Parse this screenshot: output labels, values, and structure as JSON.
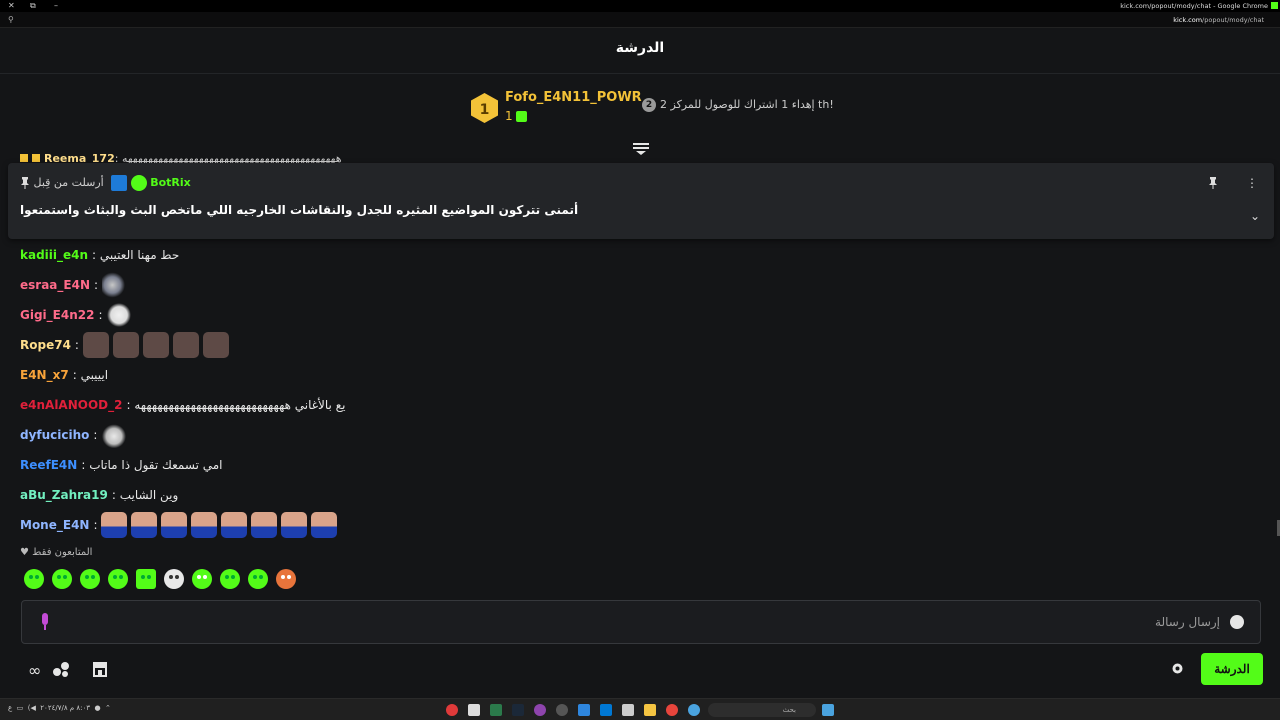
{
  "browser": {
    "app_title": "kick.com/popout/mody/chat - Google Chrome",
    "url_domain": "kick.com",
    "url_path": "/popout/mody/chat"
  },
  "header": {
    "title": "الدرشة"
  },
  "leaderboard": {
    "rank": "1",
    "top_user": "Fofo_E4N11_POWR",
    "top_count": "1",
    "next_rank_badge": "2",
    "next_text": "إهداء 1 اشتراك للوصول للمركز 2 th!"
  },
  "peek": {
    "user": "Reema_172",
    "text": ": ههههههههههههههههههههههههههههههههههههههههههه"
  },
  "pinned": {
    "author": "BotRix",
    "sent_before": "أرسلت من قِبل",
    "message": "أتمنى تتركون المواضيع المثيره للجدل والنقاشات الخارجيه اللي ماتخص البث والبثاث واستمتعوا"
  },
  "messages": [
    {
      "user": "kadiii_e4n",
      "sep": ":",
      "text": "حط مهنا العتيبي",
      "color": "#53fc18"
    },
    {
      "user": "esraa_E4N",
      "sep": ":",
      "text": "",
      "color": "#ff6b8a"
    },
    {
      "user": "Gigi_E4n22",
      "sep": ":",
      "text": "",
      "color": "#ff6b8a"
    },
    {
      "user": "Rope74",
      "sep": ":",
      "text": "",
      "color": "#ffde8c"
    },
    {
      "user": "E4N_x7",
      "sep": ":",
      "text": "ايييبي",
      "color": "#f7a33a"
    },
    {
      "user": "e4nAlANOOD_2",
      "sep": ":",
      "text": "يع بالأغاني هههههههههههههههههههههههههههه",
      "color": "#e0203a"
    },
    {
      "user": "dyfuciciho",
      "sep": ":",
      "text": "",
      "color": "#8fb5ff"
    },
    {
      "user": "ReefE4N",
      "sep": ":",
      "text": "امي تسمعك تقول ذا ماتاب",
      "color": "#3d8fff"
    },
    {
      "user": "aBu_Zahra19",
      "sep": ":",
      "text": "وين الشايب",
      "color": "#72f0c0"
    },
    {
      "user": "Mone_E4N",
      "sep": ":",
      "text": "",
      "color": "#8fb5ff"
    }
  ],
  "followers_only": "المتابعون فقط",
  "input": {
    "placeholder": "إرسال رسالة"
  },
  "send_button": "الدرشة",
  "taskbar": {
    "search_placeholder": "بحث",
    "tray_lang": "ع",
    "clock_time": "٨:٠٣ م",
    "clock_date": "٢٠٢٤/٧/٨"
  },
  "colors": {
    "accent": "#53fc18",
    "bg": "#141517",
    "gold": "#f3c238"
  }
}
